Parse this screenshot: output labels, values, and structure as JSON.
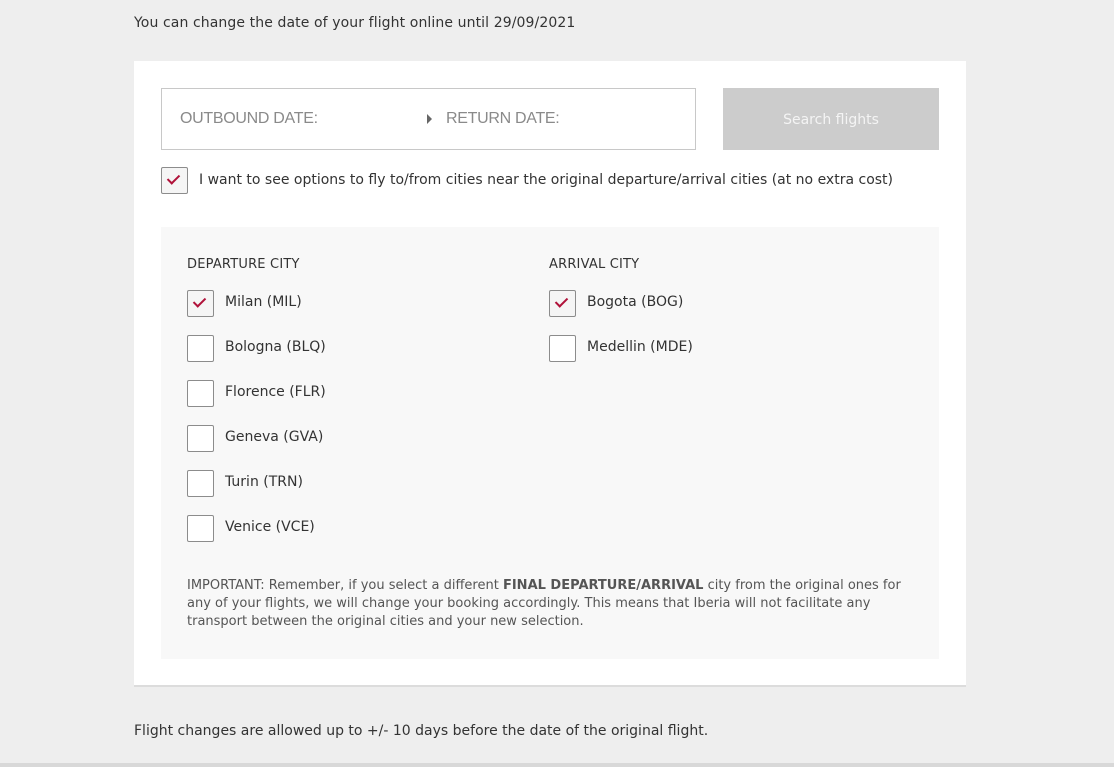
{
  "top_note": "You can change the date of your flight online until 29/09/2021",
  "dates": {
    "outbound_label": "OUTBOUND DATE:",
    "return_label": "RETURN DATE:"
  },
  "search_button_label": "Search flights",
  "nearby_option": {
    "label": "I want to see options to fly to/from cities near the original departure/arrival cities (at no extra cost)",
    "checked": true
  },
  "departure": {
    "heading": "DEPARTURE CITY",
    "cities": [
      {
        "label": "Milan (MIL)",
        "checked": true
      },
      {
        "label": "Bologna (BLQ)",
        "checked": false
      },
      {
        "label": "Florence (FLR)",
        "checked": false
      },
      {
        "label": "Geneva (GVA)",
        "checked": false
      },
      {
        "label": "Turin (TRN)",
        "checked": false
      },
      {
        "label": "Venice (VCE)",
        "checked": false
      }
    ]
  },
  "arrival": {
    "heading": "ARRIVAL CITY",
    "cities": [
      {
        "label": "Bogota (BOG)",
        "checked": true
      },
      {
        "label": "Medellin (MDE)",
        "checked": false
      }
    ]
  },
  "important": {
    "prefix": "IMPORTANT: Remember, if you select a different ",
    "bold": "FINAL DEPARTURE/ARRIVAL",
    "suffix": " city from the original ones for any of your flights, we will change your booking accordingly. This means that Iberia will not facilitate any transport between the original cities and your new selection."
  },
  "bottom_note": "Flight changes are allowed up to +/- 10 days before the date of the original flight.",
  "colors": {
    "check_accent": "#b0123a",
    "button_disabled": "#cccccc"
  }
}
